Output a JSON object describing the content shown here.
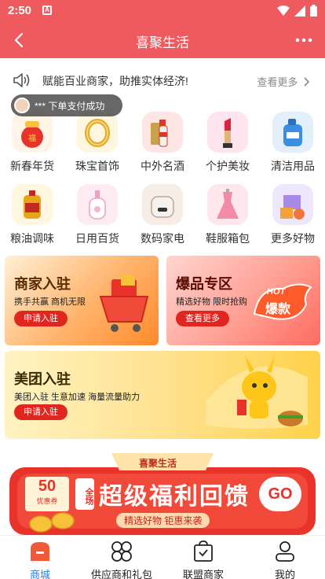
{
  "status": {
    "time": "2:50",
    "notif": "A"
  },
  "header": {
    "title": "喜聚生活"
  },
  "notice": {
    "text": "赋能百业商家，助推实体经济!",
    "more": "查看更多"
  },
  "toast": {
    "text": "*** 下单支付成功"
  },
  "categories": [
    {
      "label": "新春年货",
      "icon": "gift-bag-icon",
      "color": "#f15a3c"
    },
    {
      "label": "珠宝首饰",
      "icon": "bracelet-icon",
      "color": "#e8b544"
    },
    {
      "label": "中外名酒",
      "icon": "liquor-icon",
      "color": "#d84a3a"
    },
    {
      "label": "个护美妆",
      "icon": "lipstick-icon",
      "color": "#e84a6a"
    },
    {
      "label": "清洁用品",
      "icon": "detergent-icon",
      "color": "#3a8fe0"
    },
    {
      "label": "粮油调味",
      "icon": "oil-icon",
      "color": "#e8b020"
    },
    {
      "label": "日用百货",
      "icon": "lotion-icon",
      "color": "#f0a0c0"
    },
    {
      "label": "数码家电",
      "icon": "rice-cooker-icon",
      "color": "#c8b8a8"
    },
    {
      "label": "鞋服箱包",
      "icon": "dress-icon",
      "color": "#f08aa8"
    },
    {
      "label": "更多好物",
      "icon": "boxes-icon",
      "color": "#9a7ae0"
    }
  ],
  "banners": {
    "merchant": {
      "title": "商家入驻",
      "sub": "携手共赢 商机无限",
      "btn": "申请入驻"
    },
    "hot": {
      "title": "爆品专区",
      "sub": "精选好物 限时抢购",
      "btn": "查看更多",
      "badge_top": "HOT",
      "badge_bottom": "爆款"
    },
    "meituan": {
      "title": "美团入驻",
      "sub": "美团入驻 生意加速 海量流量助力",
      "btn": "申请入驻"
    }
  },
  "promo": {
    "tag": "喜聚生活",
    "side": "全场",
    "title": "超级福利回馈",
    "go": "GO",
    "sub": "精选好物 钜惠来袭",
    "coupon": "50",
    "coupon_sub": "优惠券"
  },
  "tabs": [
    {
      "label": "商城",
      "icon": "shop-icon"
    },
    {
      "label": "供应商和礼包",
      "icon": "grid-icon"
    },
    {
      "label": "联盟商家",
      "icon": "bag-icon"
    },
    {
      "label": "我的",
      "icon": "user-icon"
    }
  ],
  "colors": {
    "brand": "#ef5a5f",
    "active_tab": "#2b7de9"
  }
}
